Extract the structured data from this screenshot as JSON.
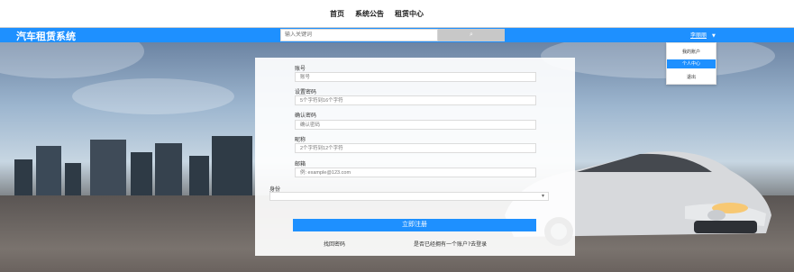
{
  "topnav": {
    "links": [
      "首页",
      "系统公告",
      "租赁中心"
    ]
  },
  "header": {
    "brand": "汽车租赁系统",
    "search_placeholder": "输入关键词",
    "user_name": "李丽丽"
  },
  "user_menu": {
    "items": [
      "我的账户",
      "个人中心",
      "退出"
    ],
    "active_index": 1
  },
  "form": {
    "fields": [
      {
        "label": "账号",
        "placeholder": "账号"
      },
      {
        "label": "设置密码",
        "placeholder": "5个字符到16个字符"
      },
      {
        "label": "确认密码",
        "placeholder": "确认密码"
      },
      {
        "label": "昵称",
        "placeholder": "2个字符到12个字符"
      },
      {
        "label": "邮箱",
        "placeholder": "例: example@123.com"
      }
    ],
    "identity_label": "身份",
    "submit_label": "立即注册",
    "find_password": "找回密码",
    "login_link": "是否已经拥有一个账户?去登录"
  },
  "colors": {
    "primary": "#1e90ff"
  }
}
